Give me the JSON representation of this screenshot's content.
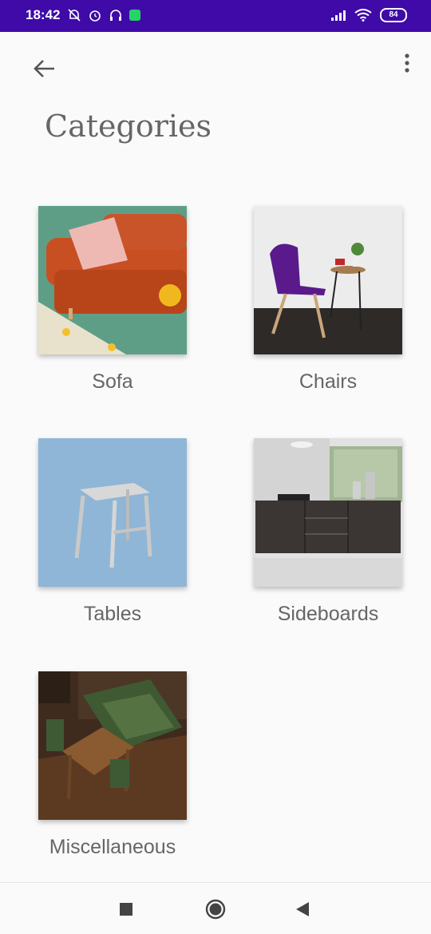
{
  "status_bar": {
    "time": "18:42",
    "battery": "84",
    "icons_left": [
      "bell-off-icon",
      "alarm-icon",
      "headphones-icon",
      "whatsapp-icon"
    ],
    "icons_right": [
      "signal-icon",
      "wifi-icon",
      "battery-icon"
    ]
  },
  "toolbar": {
    "back_icon": "arrow-left-icon",
    "menu_icon": "more-vert-icon"
  },
  "page": {
    "title": "Categories"
  },
  "categories": [
    {
      "label": "Sofa"
    },
    {
      "label": "Chairs"
    },
    {
      "label": "Tables"
    },
    {
      "label": "Sideboards"
    },
    {
      "label": "Miscellaneous"
    }
  ],
  "nav_bar": {
    "icons": [
      "recents-icon",
      "home-icon",
      "back-icon"
    ]
  },
  "colors": {
    "status_bar": "#3f0aa8",
    "background": "#fafafa",
    "text": "#666666"
  }
}
